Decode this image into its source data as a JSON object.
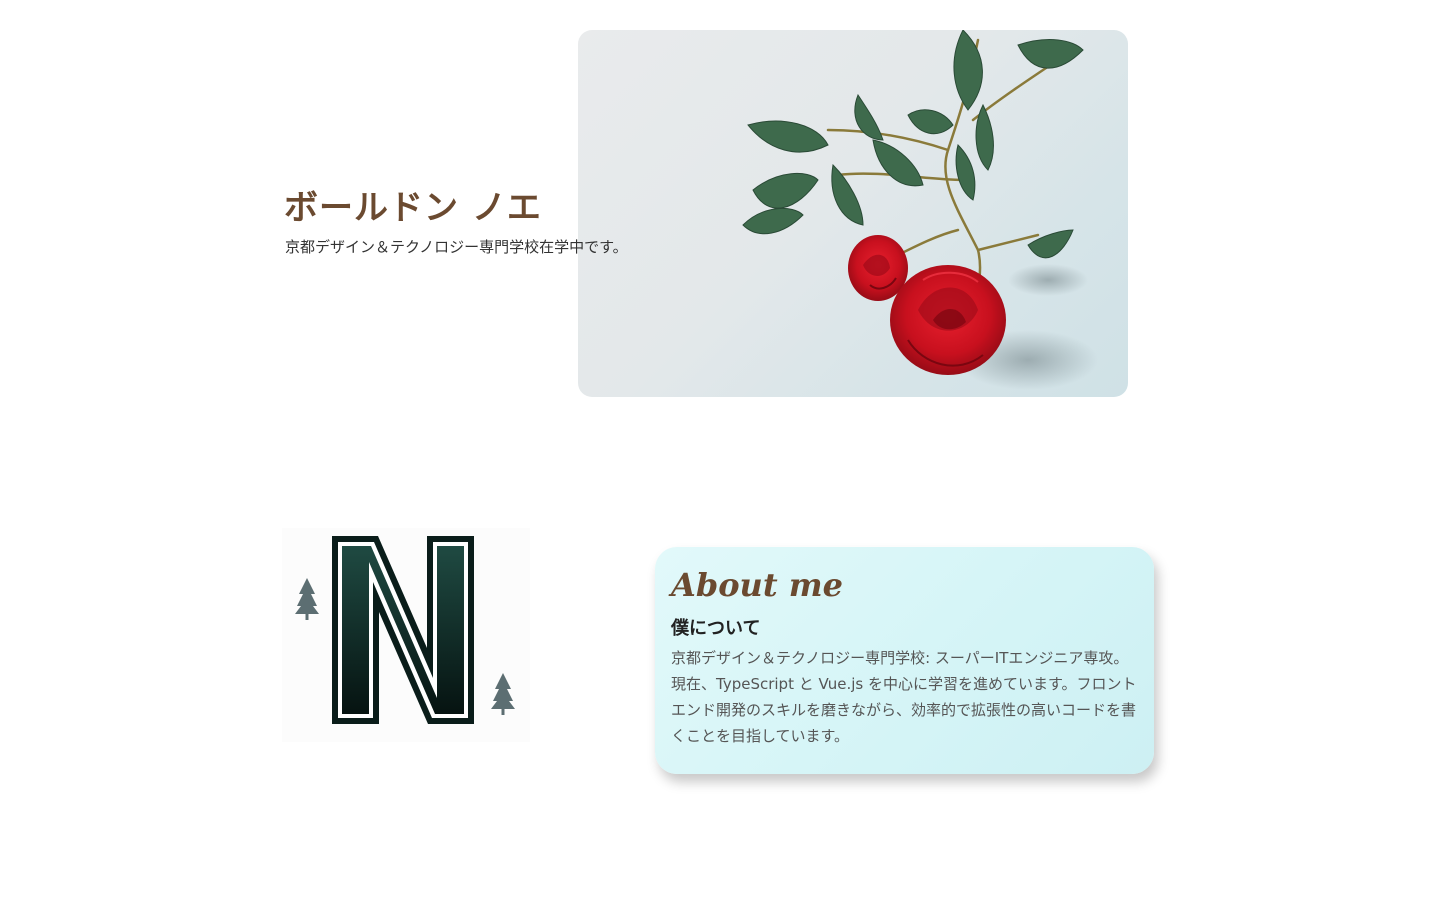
{
  "hero": {
    "name": "ボールドン ノエ",
    "subtitle": "京都デザイン＆テクノロジー専門学校在学中です。",
    "image_icon": "rose-photo-icon"
  },
  "logo": {
    "letter": "N",
    "icon": "n-logo-icon"
  },
  "about": {
    "title": "About me",
    "subtitle": "僕について",
    "body": "京都デザイン＆テクノロジー専門学校: スーパーITエンジニア専攻。 現在、TypeScript と Vue.js を中心に学習を進めています。フロントエンド開発のスキルを磨きながら、効率的で拡張性の高いコードを書くことを目指しています。"
  },
  "colors": {
    "accent_brown": "#6b4a30",
    "card_bg": "#d6f5f7",
    "logo_green": "#0f2f2a"
  }
}
